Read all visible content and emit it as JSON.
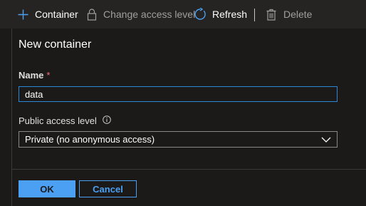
{
  "toolbar": {
    "container_label": "Container",
    "access_label": "Change access level",
    "refresh_label": "Refresh",
    "delete_label": "Delete"
  },
  "dialog": {
    "title": "New container",
    "name_label": "Name",
    "required_marker": "*",
    "name_value": "data",
    "access_label": "Public access level",
    "access_selected": "Private (no anonymous access)",
    "ok_label": "OK",
    "cancel_label": "Cancel"
  },
  "colors": {
    "accent": "#4ba0f3",
    "required": "#f1707b",
    "input_focus_border": "#2b88d8",
    "background": "#1b1a19"
  }
}
